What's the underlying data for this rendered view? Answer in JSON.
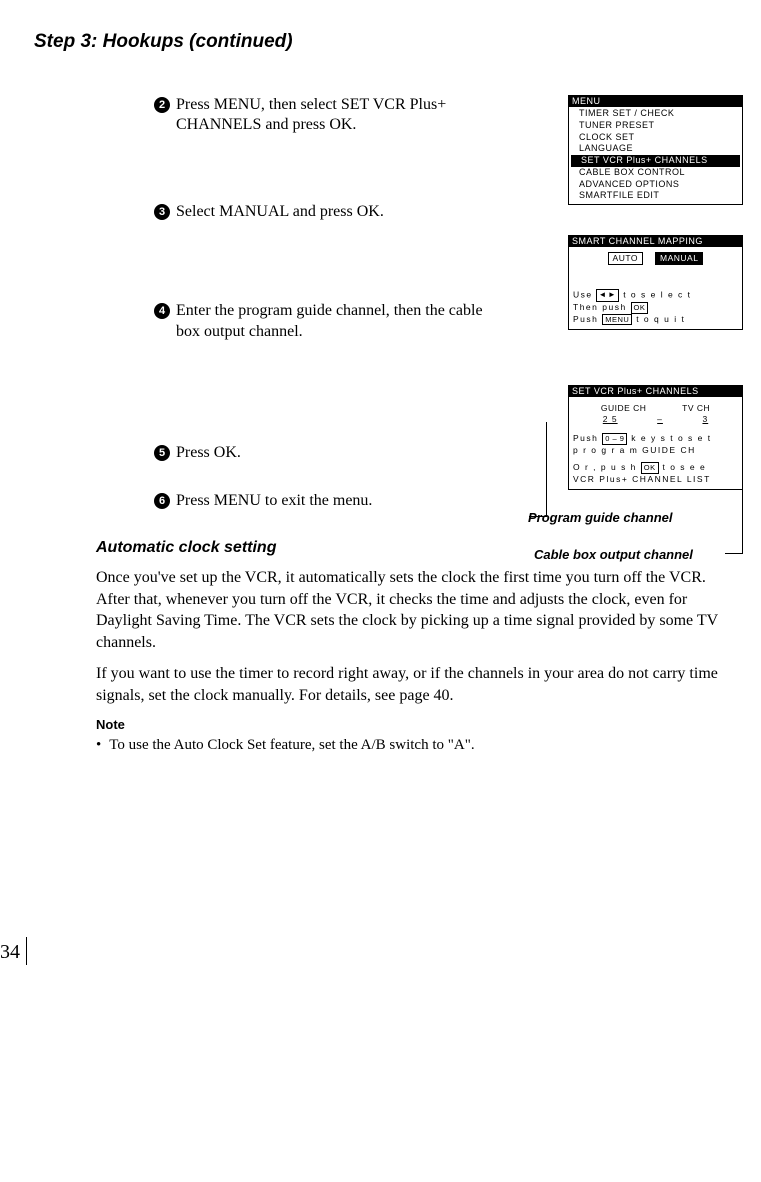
{
  "page_title": "Step 3: Hookups (continued)",
  "steps": [
    {
      "n": "2",
      "text": "Press MENU, then select SET VCR Plus+ CHANNELS and press OK."
    },
    {
      "n": "3",
      "text": "Select MANUAL and press OK."
    },
    {
      "n": "4",
      "text": "Enter the program guide channel, then the cable box output channel."
    },
    {
      "n": "5",
      "text": "Press OK."
    },
    {
      "n": "6",
      "text": "Press MENU to exit the menu."
    }
  ],
  "osd1": {
    "title": "MENU",
    "items": [
      "TIMER  SET / CHECK",
      "TUNER  PRESET",
      "CLOCK  SET",
      "LANGUAGE",
      "SET  VCR  Plus+  CHANNELS",
      "CABLE  BOX  CONTROL",
      "ADVANCED  OPTIONS",
      "SMARTFILE  EDIT"
    ],
    "selected_index": 4
  },
  "osd2": {
    "title": "SMART  CHANNEL  MAPPING",
    "options": {
      "left": "AUTO",
      "right": "MANUAL"
    },
    "instr1_pre": "Use ",
    "instr1_post": " t o   s e l e c t",
    "instr2_pre": "Then  push ",
    "instr2_key": "OK",
    "instr3_pre": "Push ",
    "instr3_key": "MENU",
    "instr3_post": " t o   q u i t"
  },
  "osd3": {
    "title": "SET  VCR  Plus+  CHANNELS",
    "col1": "GUIDE    CH",
    "col2": "TV   CH",
    "val1": "2 5",
    "valmid": "–",
    "val2": "3",
    "instr1_pre": "Push ",
    "instr1_key": "0 – 9",
    "instr1_post": "  k e y s   t o   s e t",
    "instr2": "p r o g r a m  GUIDE  CH",
    "instr3_pre": "O r , p u s h ",
    "instr3_key": "OK",
    "instr3_post": "  t o   s e e",
    "instr4": " VCR  Plus+  CHANNEL  LIST"
  },
  "callouts": {
    "guide": "Program guide channel",
    "cable": "Cable box output channel"
  },
  "section_subtitle": "Automatic clock setting",
  "para1": "Once you've set up the VCR, it automatically sets the clock the first time you turn off the VCR.  After that, whenever you turn off the VCR, it checks the time and adjusts the clock, even for Daylight Saving Time.  The VCR sets the clock by picking up a time signal provided by some TV channels.",
  "para2": "If you want to use the timer to record right away, or if the channels in your area do not carry time signals, set the clock manually.  For details, see page 40.",
  "note_head": "Note",
  "note_bullet": "To use the Auto Clock Set feature, set the A/B switch to \"A\".",
  "page_number": "34"
}
